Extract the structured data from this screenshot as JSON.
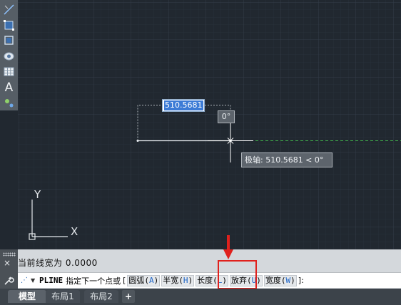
{
  "toolbar": {
    "tools": [
      {
        "name": "line-tool-icon"
      },
      {
        "name": "rectangle-tool-icon"
      },
      {
        "name": "region-tool-icon"
      },
      {
        "name": "camera-tool-icon"
      },
      {
        "name": "table-tool-icon"
      },
      {
        "name": "text-tool-icon",
        "glyph": "A"
      },
      {
        "name": "point-tool-icon"
      }
    ]
  },
  "canvas": {
    "dynamic_input_value": "510.5681",
    "angle_tooltip": "0°",
    "polar_tooltip": "极轴: 510.5681 < 0°",
    "ucs_axes": {
      "x": "X",
      "y": "Y"
    }
  },
  "command": {
    "history_line": "当前线宽为 0.0000",
    "close_icon": "×",
    "command_name": "PLINE",
    "prompt": "指定下一个点或",
    "open_bracket": "[",
    "close_bracket": "]:",
    "options": [
      {
        "label": "圆弧",
        "key": "A"
      },
      {
        "label": "半宽",
        "key": "H"
      },
      {
        "label": "长度",
        "key": "L"
      },
      {
        "label": "放弃",
        "key": "U"
      },
      {
        "label": "宽度",
        "key": "W"
      }
    ]
  },
  "tabs": {
    "model": "模型",
    "layout1": "布局1",
    "layout2": "布局2",
    "add": "+"
  },
  "colors": {
    "canvas_bg": "#212830",
    "highlight": "#e0211d",
    "option_key": "#1d64c6",
    "dynamic_selection": "#3c7bd6"
  }
}
